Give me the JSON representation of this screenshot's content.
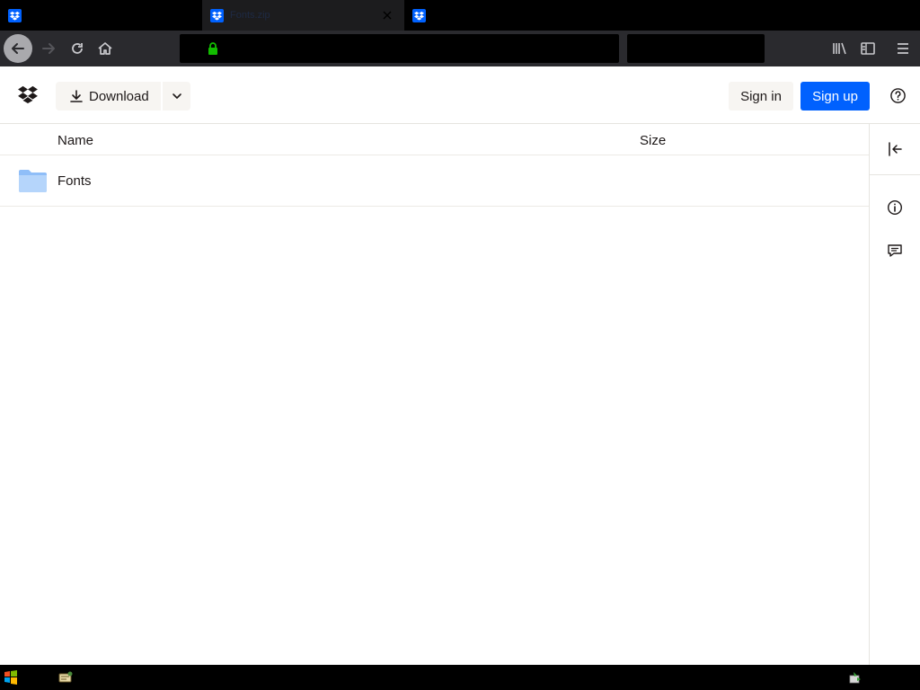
{
  "browser": {
    "tabs": [
      {
        "title": "",
        "active": false
      },
      {
        "title": "Fonts.zip",
        "active": true
      },
      {
        "title": "",
        "active": false
      }
    ],
    "colors": {
      "accent": "#0061fe",
      "lock": "#12bc00"
    }
  },
  "header": {
    "download_label": "Download",
    "signin_label": "Sign in",
    "signup_label": "Sign up"
  },
  "filelist": {
    "columns": {
      "name": "Name",
      "size": "Size"
    },
    "rows": [
      {
        "name": "Fonts",
        "size": "",
        "type": "folder"
      }
    ]
  },
  "sidepanel": {
    "icons": [
      "collapse-panel-icon",
      "info-icon",
      "comment-icon"
    ]
  },
  "taskbar": {
    "icons": [
      "windows-start-icon",
      "app-icon",
      "tray-icon"
    ]
  }
}
